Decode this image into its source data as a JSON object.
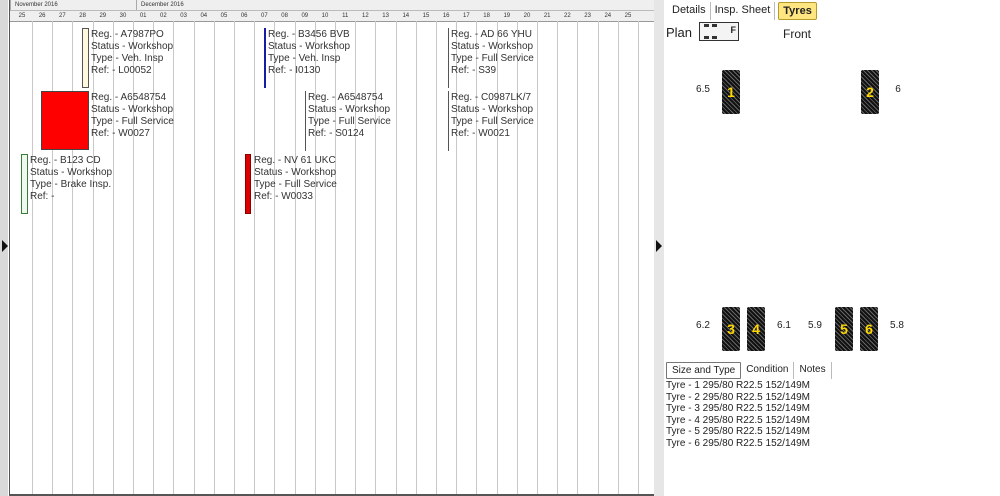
{
  "timeline": {
    "months": [
      {
        "label": "November 2016"
      },
      {
        "label": "December 2016"
      }
    ],
    "days": [
      "25",
      "26",
      "27",
      "28",
      "29",
      "30",
      "01",
      "02",
      "03",
      "04",
      "05",
      "06",
      "07",
      "08",
      "09",
      "10",
      "11",
      "12",
      "13",
      "14",
      "15",
      "16",
      "17",
      "18",
      "19",
      "20",
      "21",
      "22",
      "23",
      "24",
      "25"
    ],
    "events": [
      {
        "lines": [
          "Reg. - A7987PO",
          "Status - Workshop",
          "Type - Veh. Insp",
          "Ref: - L00052"
        ],
        "color": "#fff8dc",
        "border": "#555"
      },
      {
        "lines": [
          "Reg. - B3456 BVB",
          "Status - Workshop",
          "Type - Veh. Insp",
          "Ref: - I0130"
        ],
        "color": "#1a1aa8",
        "border": "#1a1aa8"
      },
      {
        "lines": [
          "Reg. - AD 66 YHU",
          "Status - Workshop",
          "Type - Full Service",
          "Ref: - S39"
        ],
        "color": "#555555",
        "border": "#555"
      },
      {
        "lines": [
          "Reg. - A6548754",
          "Status - Workshop",
          "Type - Full Service",
          "Ref: - W0027"
        ],
        "color": "#ff0000",
        "border": "#444"
      },
      {
        "lines": [
          "Reg. - A6548754",
          "Status - Workshop",
          "Type - Full Service",
          "Ref: - S0124"
        ],
        "color": "#555555",
        "border": "#555"
      },
      {
        "lines": [
          "Reg. - C0987LK/7",
          "Status - Workshop",
          "Type - Full Service",
          "Ref: - W0021"
        ],
        "color": "#555555",
        "border": "#555"
      },
      {
        "lines": [
          "Reg. - B123 CD",
          "Status - Workshop",
          "Type - Brake Insp.",
          "Ref: -"
        ],
        "color": "#eef8ee",
        "border": "#3a7a3a"
      },
      {
        "lines": [
          "Reg. - NV 61 UKC",
          "Status - Workshop",
          "Type - Full Service",
          "Ref: - W0033"
        ],
        "color": "#dd0000",
        "border": "#880000"
      }
    ]
  },
  "panel": {
    "tabs": [
      {
        "label": "Details",
        "active": false
      },
      {
        "label": "Insp. Sheet",
        "active": false
      },
      {
        "label": "Tyres",
        "active": true
      }
    ],
    "plan_label": "Plan",
    "plan_icon_letter": "F",
    "front_label": "Front",
    "tyres": [
      {
        "num": "1",
        "depth": "6.5"
      },
      {
        "num": "2",
        "depth": "6"
      },
      {
        "num": "3",
        "depth": "6.2"
      },
      {
        "num": "4",
        "depth": "6.1"
      },
      {
        "num": "5",
        "depth": "5.9"
      },
      {
        "num": "6",
        "depth": "5.8"
      }
    ],
    "subtabs": [
      {
        "label": "Size and Type",
        "active": true
      },
      {
        "label": "Condition",
        "active": false
      },
      {
        "label": "Notes",
        "active": false
      }
    ],
    "tyre_list": [
      "Tyre - 1 295/80 R22.5 152/149M",
      "Tyre - 2 295/80 R22.5 152/149M",
      "Tyre - 3 295/80 R22.5 152/149M",
      "Tyre - 4 295/80 R22.5 152/149M",
      "Tyre - 5 295/80 R22.5 152/149M",
      "Tyre - 6 295/80 R22.5 152/149M"
    ]
  }
}
